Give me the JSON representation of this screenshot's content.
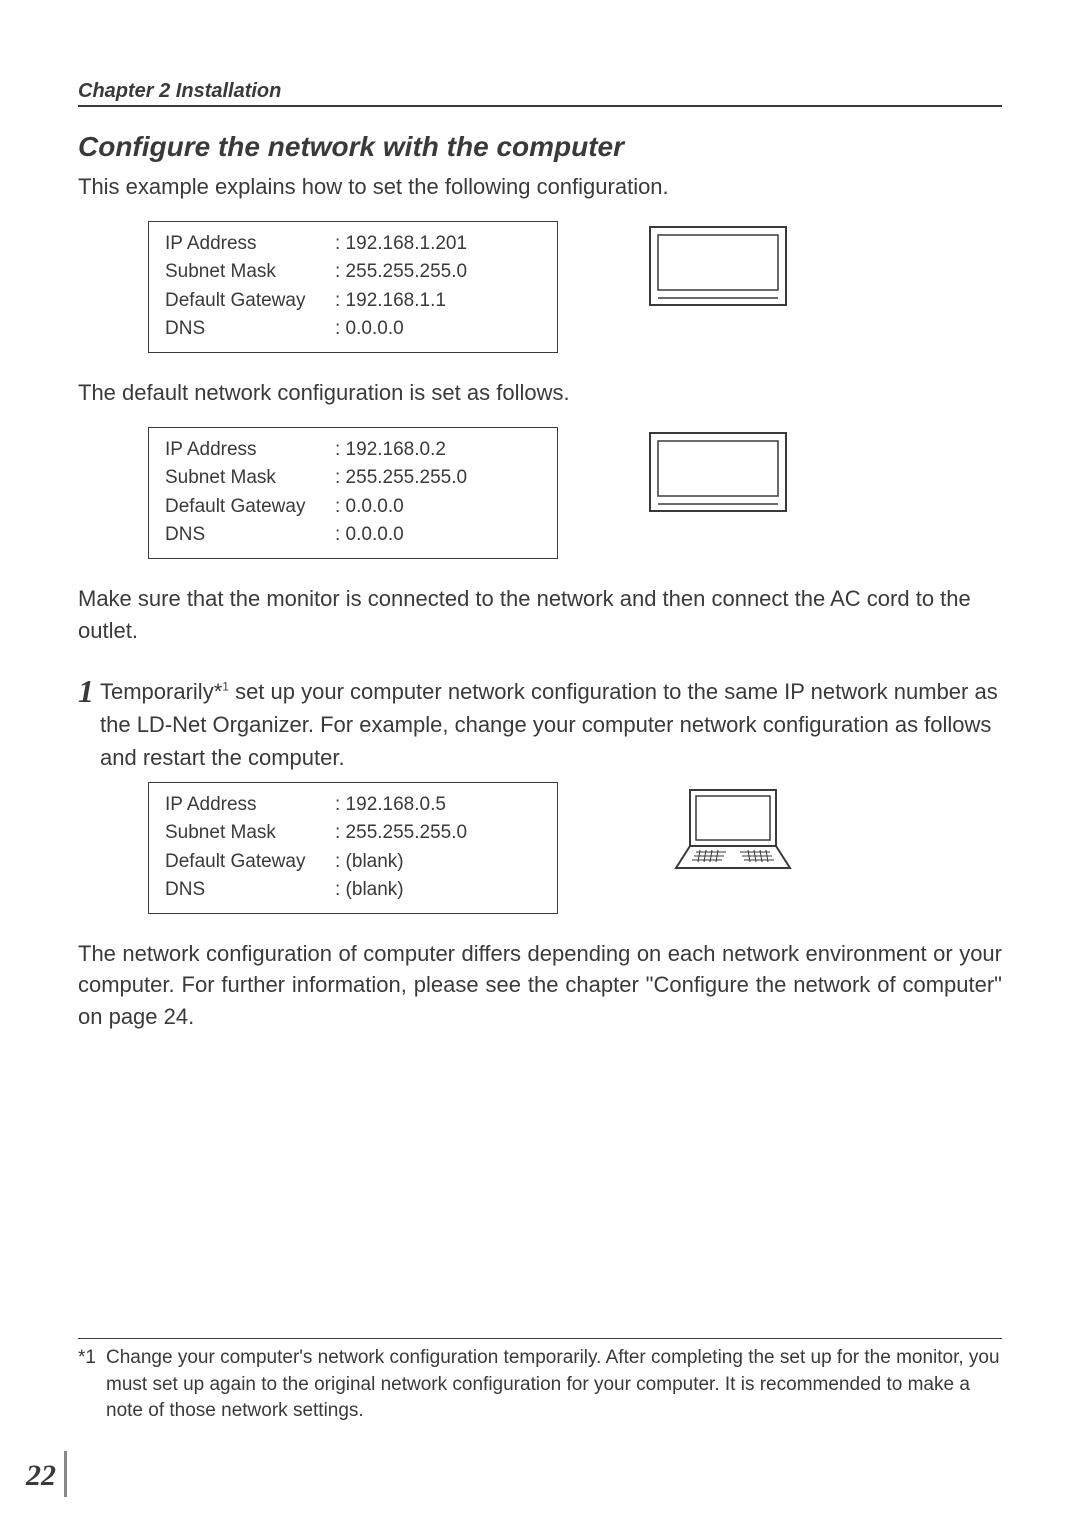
{
  "chapter_header": "Chapter 2 Installation",
  "section_title": "Configure the network with the computer",
  "intro_text": "This example explains how to set the following configuration.",
  "config1": {
    "rows": [
      {
        "label": "IP Address",
        "value": ": 192.168.1.201"
      },
      {
        "label": "Subnet Mask",
        "value": ": 255.255.255.0"
      },
      {
        "label": "Default Gateway",
        "value": ": 192.168.1.1"
      },
      {
        "label": "DNS",
        "value": ": 0.0.0.0"
      }
    ]
  },
  "default_text": "The default network configuration is set as follows.",
  "config2": {
    "rows": [
      {
        "label": "IP Address",
        "value": ": 192.168.0.2"
      },
      {
        "label": "Subnet Mask",
        "value": ": 255.255.255.0"
      },
      {
        "label": "Default Gateway",
        "value": ": 0.0.0.0"
      },
      {
        "label": "DNS",
        "value": ": 0.0.0.0"
      }
    ]
  },
  "connect_text": "Make sure that the monitor is connected to the network and then connect the AC cord to the outlet.",
  "step1_num": "1",
  "step1_text_pre": "Temporarily*",
  "step1_sup": "1",
  "step1_text_post": " set up your computer network configuration to the same IP network number as the LD-Net Organizer. For example, change your computer network configuration as follows and restart the computer.",
  "config3": {
    "rows": [
      {
        "label": "IP Address",
        "value": ": 192.168.0.5"
      },
      {
        "label": "Subnet Mask",
        "value": ": 255.255.255.0"
      },
      {
        "label": "Default Gateway",
        "value": ": (blank)"
      },
      {
        "label": "DNS",
        "value": ": (blank)"
      }
    ]
  },
  "final_text": "The network configuration of computer differs depending on each network environment or your computer. For further information, please see the chapter \"Configure the network of computer\" on page 24.",
  "footnote_mark": "*1",
  "footnote_text": "Change your computer's network configuration temporarily. After completing the set up for the monitor, you must set up again to the original network configuration for your computer. It is recommended to make a note of those network settings.",
  "page_number": "22"
}
